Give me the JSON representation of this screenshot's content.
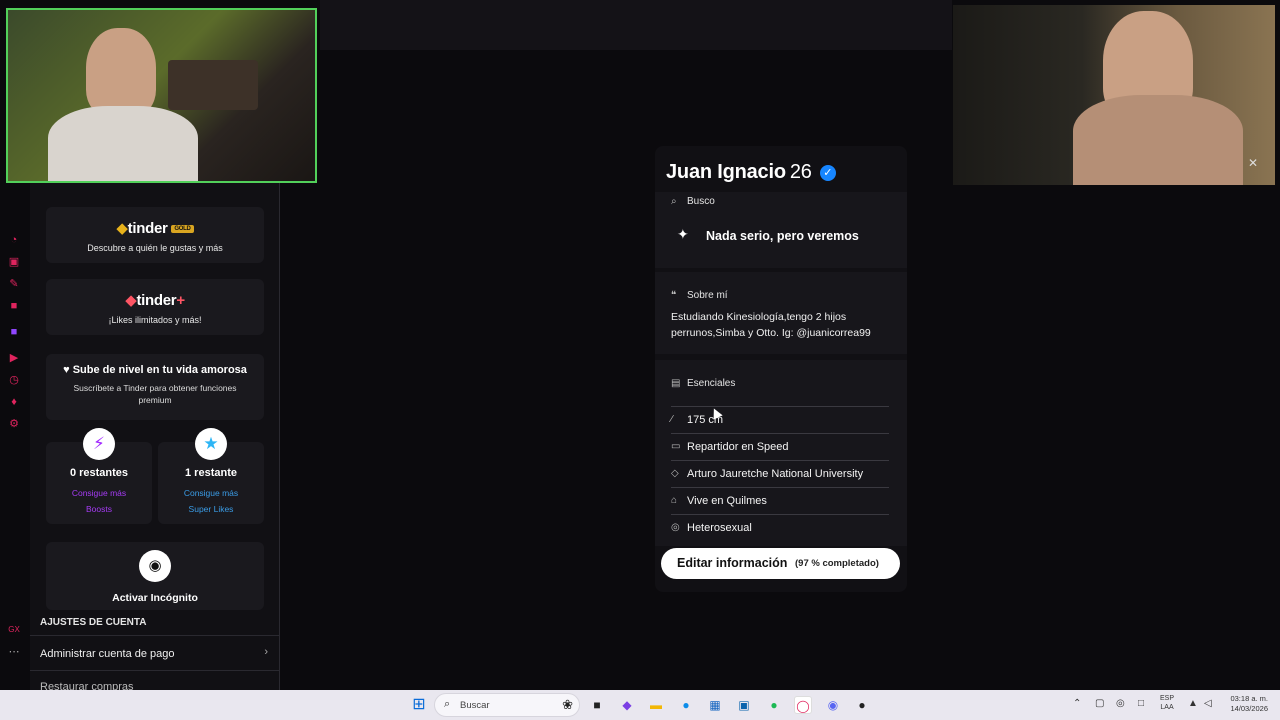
{
  "left_panel": {
    "gold": {
      "brand": "tinder",
      "tag": "GOLD",
      "subtitle": "Descubre a quién le gustas y más"
    },
    "plus": {
      "brand": "tinder",
      "plus": "+",
      "subtitle": "¡Likes ilimitados y más!"
    },
    "level_up": {
      "title": "Sube de nivel en tu vida amorosa",
      "subtitle": "Suscríbete a Tinder para obtener funciones premium"
    },
    "boosts": {
      "count_label": "0 restantes",
      "link_line1": "Consigue más",
      "link_line2": "Boosts"
    },
    "superlikes": {
      "count_label": "1 restante",
      "link_line1": "Consigue más",
      "link_line2": "Super Likes"
    },
    "incognito": {
      "label": "Activar Incógnito"
    },
    "account_settings_title": "AJUSTES DE CUENTA",
    "manage_payment": "Administrar cuenta de pago",
    "restore_purchases": "Restaurar compras"
  },
  "profile": {
    "name": "Juan Ignacio",
    "age": "26",
    "looking_for": {
      "label": "Busco",
      "value": "Nada serio, pero veremos"
    },
    "about": {
      "label": "Sobre mí",
      "text": "Estudiando Kinesiología,tengo 2 hijos perrunos,Simba y Otto. Ig: @juanicorrea99"
    },
    "essentials": {
      "label": "Esenciales",
      "items": [
        {
          "icon": "ruler-icon",
          "value": "175 cm"
        },
        {
          "icon": "briefcase-icon",
          "value": "Repartidor en Speed"
        },
        {
          "icon": "graduation-cap-icon",
          "value": "Arturo Jauretche National University"
        },
        {
          "icon": "home-icon",
          "value": "Vive en Quilmes"
        },
        {
          "icon": "orientation-icon",
          "value": "Heterosexual"
        }
      ]
    },
    "edit_button": {
      "label": "Editar información",
      "completion": "(97 % completado)"
    }
  },
  "taskbar": {
    "search_placeholder": "Buscar",
    "language_line1": "ESP",
    "language_line2": "LAA",
    "time": "03:18 a. m.",
    "date": "14/03/2026"
  },
  "colors": {
    "accent": "#fd5564",
    "boost_purple": "#a128ff",
    "superlike_blue": "#2db5f5",
    "verified_blue": "#1786ff",
    "webcam_border": "#52d05a"
  }
}
